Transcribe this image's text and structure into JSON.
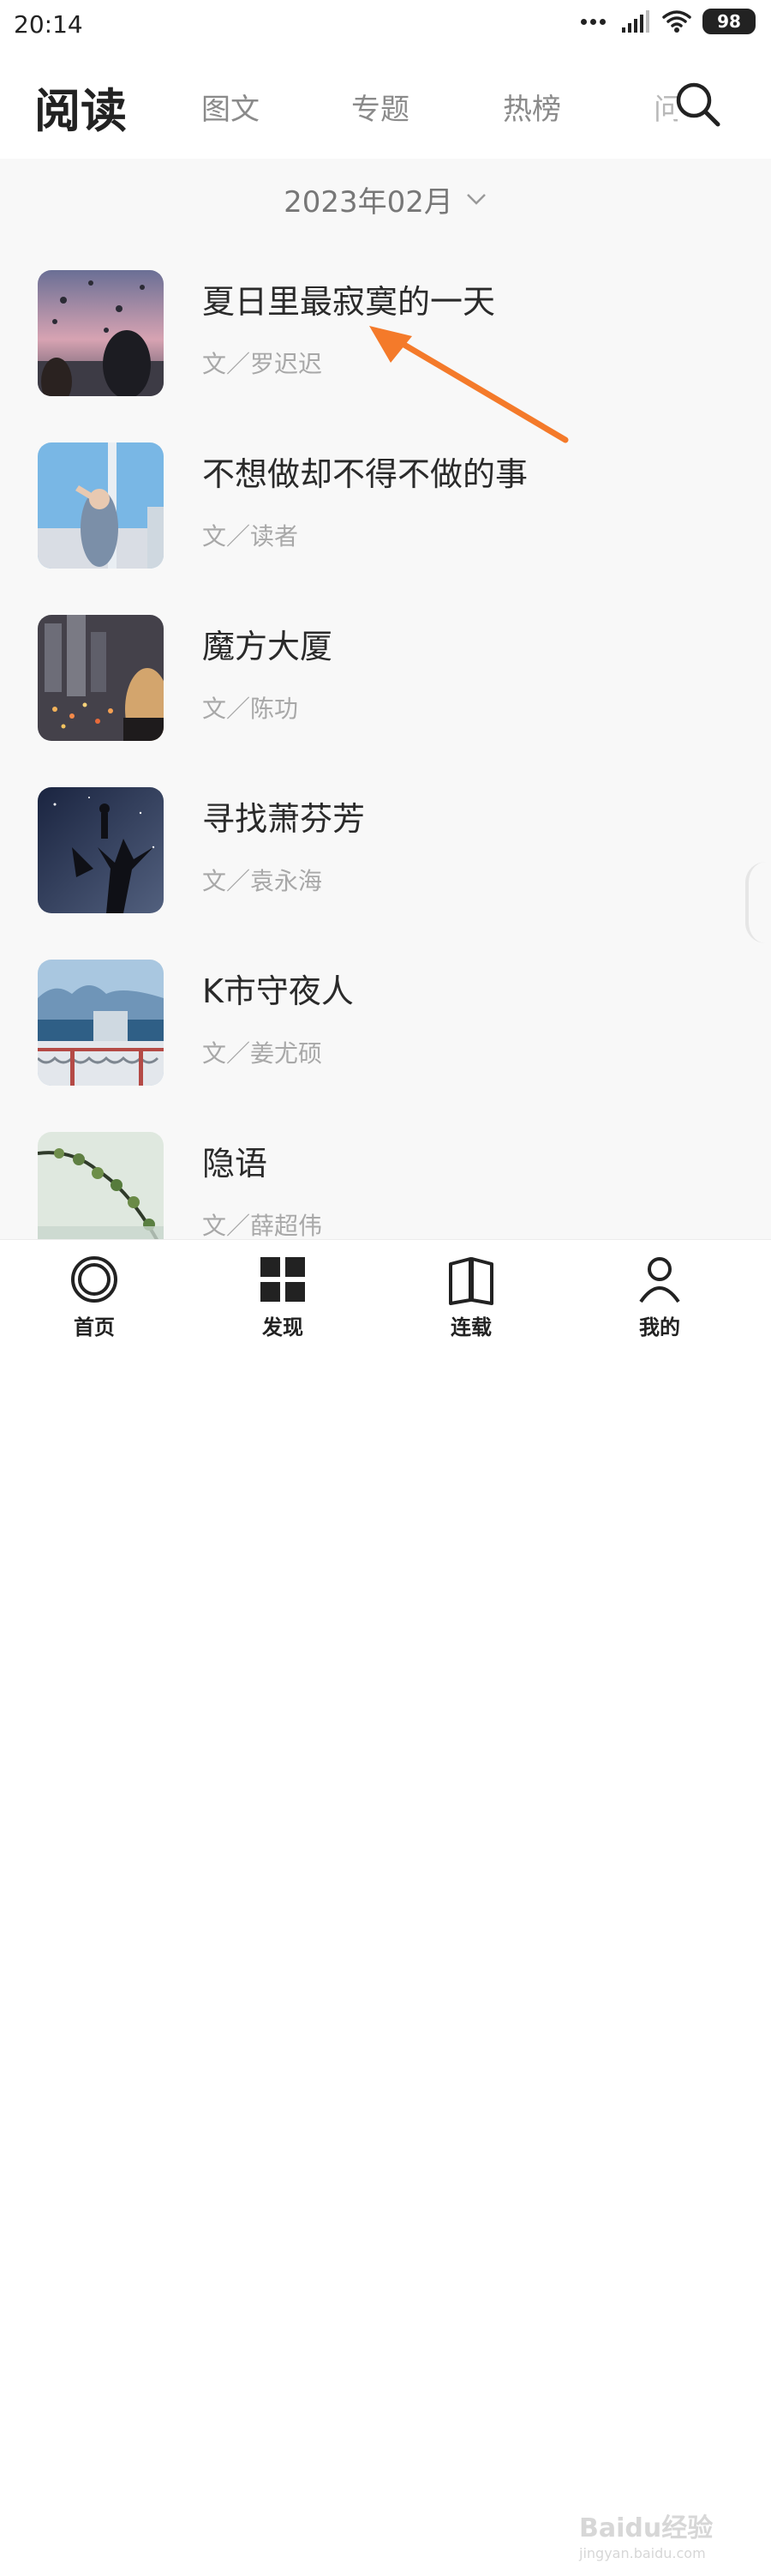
{
  "status": {
    "time": "20:14",
    "battery": "98"
  },
  "header": {
    "title": "阅读",
    "tabs": [
      {
        "label": "图文"
      },
      {
        "label": "专题"
      },
      {
        "label": "热榜"
      },
      {
        "label": "问"
      }
    ]
  },
  "date_filter": {
    "label": "2023年02月"
  },
  "articles": [
    {
      "title": "夏日里最寂寞的一天",
      "author": "文／罗迟迟"
    },
    {
      "title": "不想做却不得不做的事",
      "author": "文／读者"
    },
    {
      "title": "魔方大厦",
      "author": "文／陈功"
    },
    {
      "title": "寻找萧芬芳",
      "author": "文／袁永海"
    },
    {
      "title": "K市守夜人",
      "author": "文／姜尤硕"
    },
    {
      "title": "隐语",
      "author": "文／薛超伟"
    }
  ],
  "bottom_nav": [
    {
      "label": "首页",
      "icon": "home-circle-icon"
    },
    {
      "label": "发现",
      "icon": "grid-icon"
    },
    {
      "label": "连载",
      "icon": "book-icon"
    },
    {
      "label": "我的",
      "icon": "profile-icon"
    }
  ],
  "annotation": {
    "arrow_color": "#f47a2a"
  },
  "watermark": {
    "text": "Baidu经验",
    "subtext": "jingyan.baidu.com"
  }
}
